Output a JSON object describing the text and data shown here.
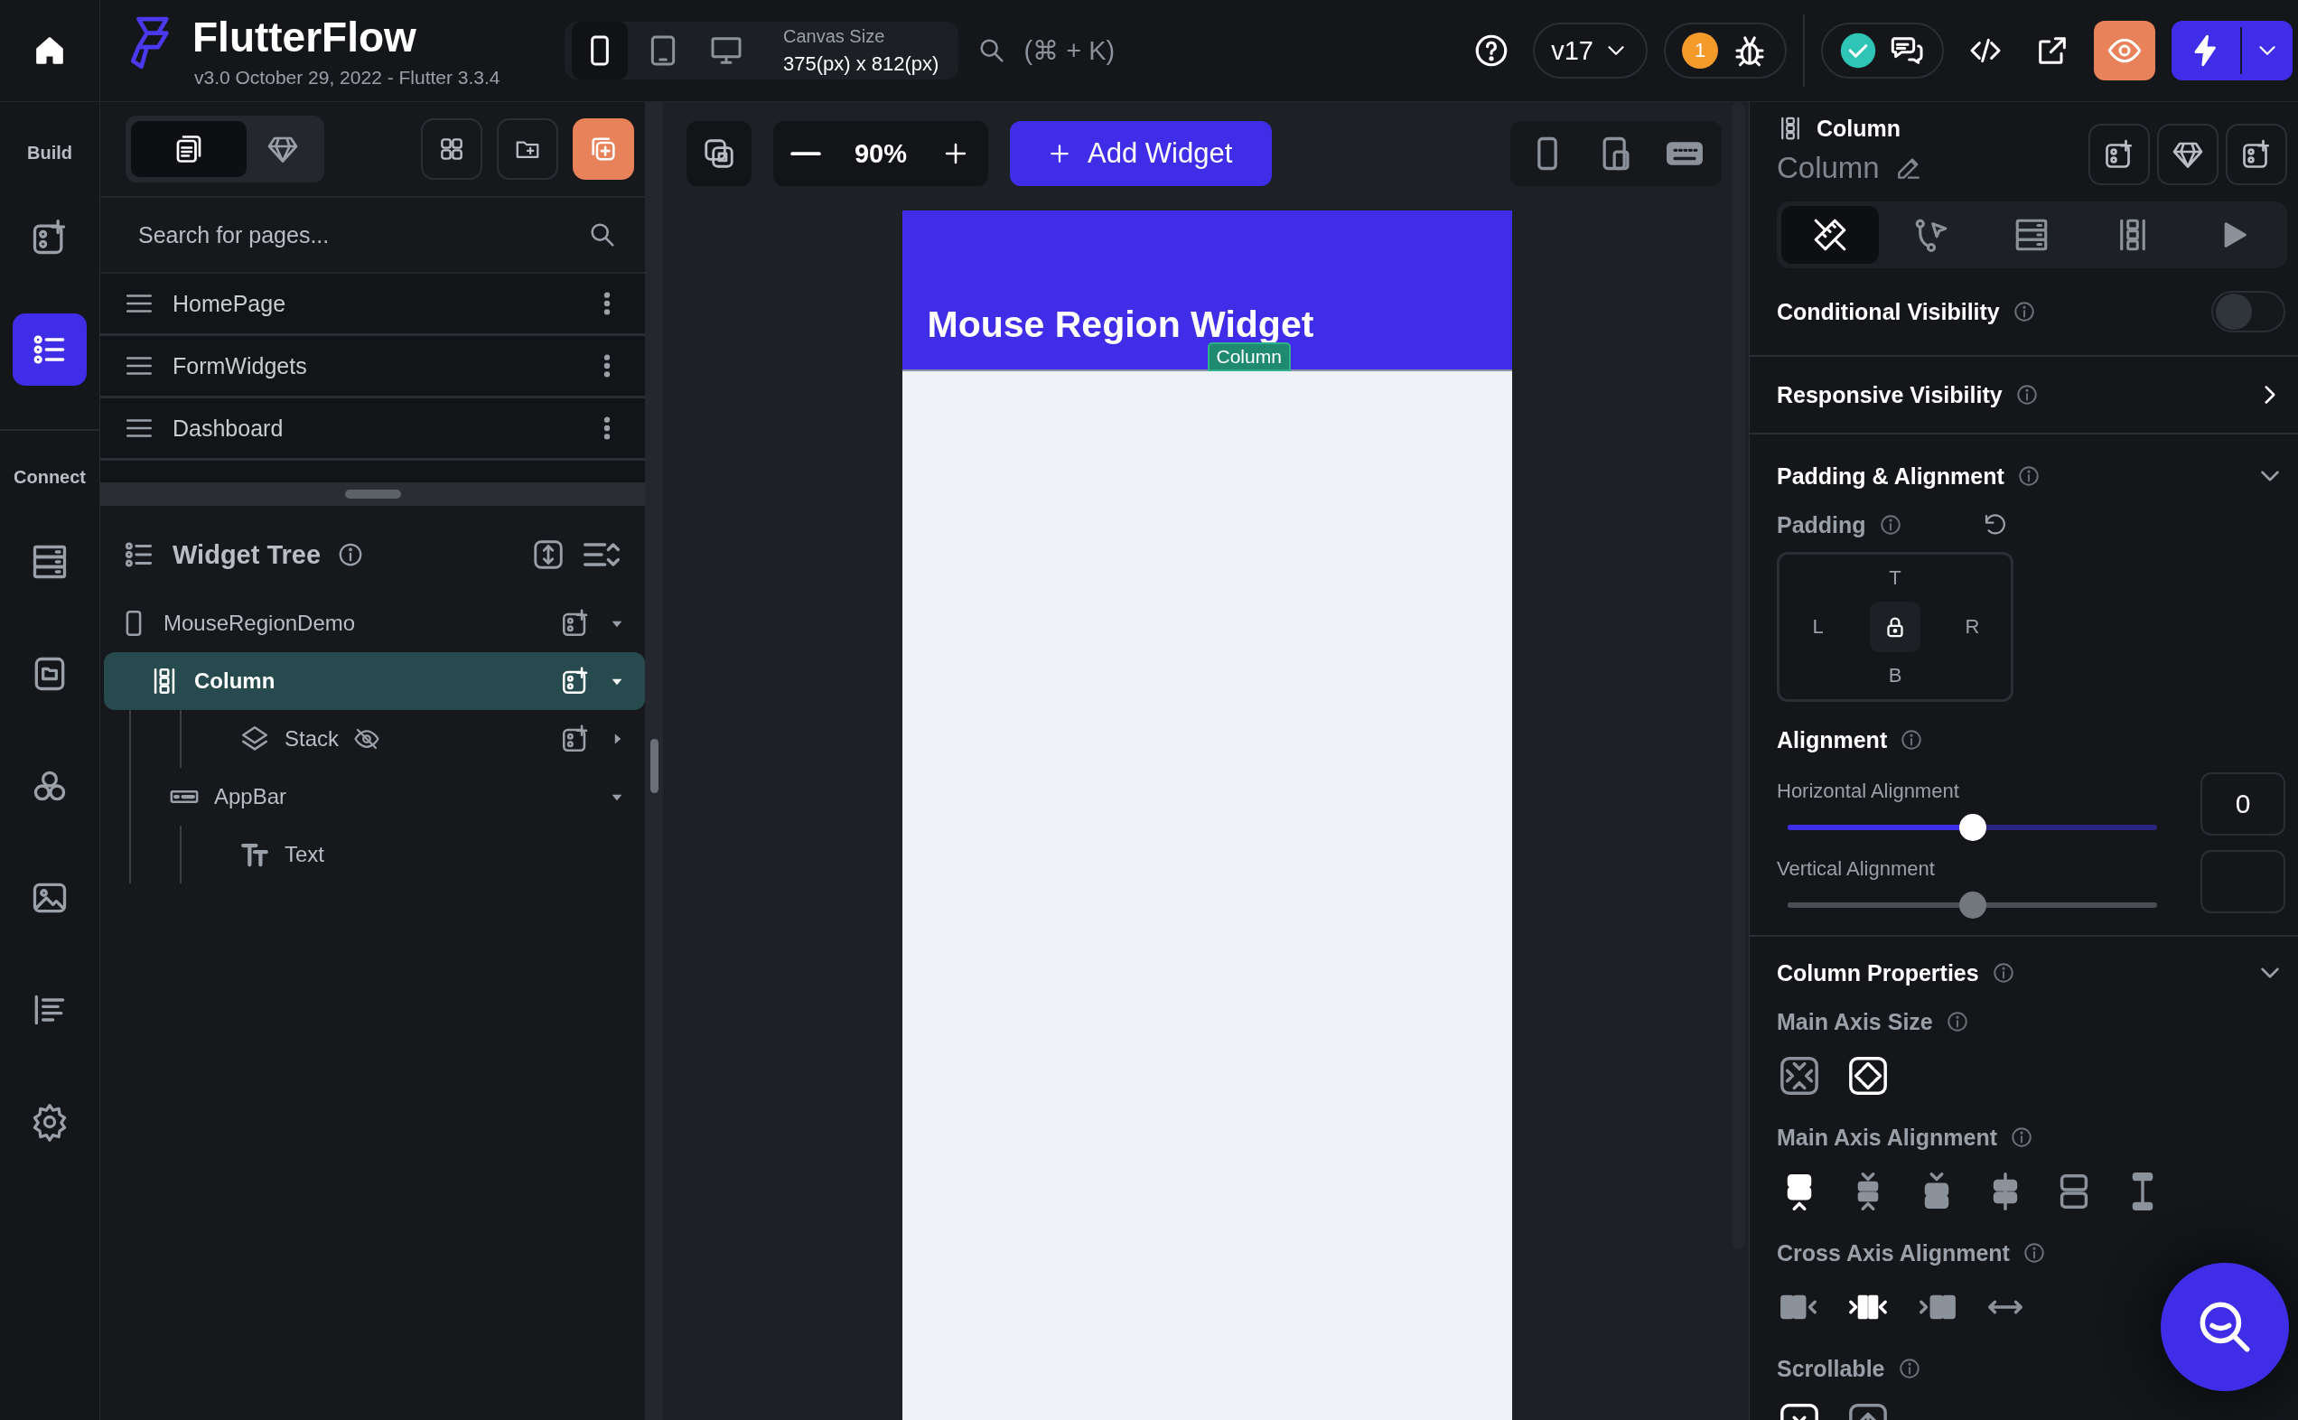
{
  "app": {
    "name": "FlutterFlow",
    "version": "v3.0 October 29, 2022 - Flutter 3.3.4"
  },
  "device_selector": {
    "devices": [
      {
        "selected": true
      },
      {
        "selected": false
      },
      {
        "selected": false
      }
    ],
    "canvas_size_label": "Canvas Size",
    "canvas_size": "375(px) x 812(px)"
  },
  "command_search": {
    "shortcut": "(⌘ + K)"
  },
  "version_dropdown": "v17",
  "issues_count": "1",
  "rail": {
    "sections": [
      {
        "label": "Build",
        "items": [
          {
            "selected": false
          },
          {
            "selected": true
          }
        ]
      },
      {
        "label": "Connect",
        "items": [
          {
            "selected": false
          },
          {
            "selected": false
          },
          {
            "selected": false
          },
          {
            "selected": false
          },
          {
            "selected": false
          },
          {
            "selected": false
          }
        ]
      }
    ]
  },
  "left_panel": {
    "tabs": [
      {
        "selected": true
      },
      {
        "selected": false
      }
    ],
    "search": {
      "placeholder": "Search for pages..."
    },
    "pages": [
      "HomePage",
      "FormWidgets",
      "Dashboard"
    ],
    "widget_tree": {
      "title": "Widget Tree",
      "nodes": [
        {
          "label": "MouseRegionDemo",
          "kind": "page",
          "selected": false,
          "expanded": true,
          "children": [
            {
              "label": "Column",
              "kind": "column",
              "selected": true,
              "expanded": true,
              "children": [
                {
                  "label": "Stack",
                  "kind": "stack",
                  "selected": false,
                  "expanded": false,
                  "hidden": true
                }
              ]
            },
            {
              "label": "AppBar",
              "kind": "appbar",
              "selected": false,
              "expanded": true,
              "children": [
                {
                  "label": "Text",
                  "kind": "text",
                  "selected": false
                }
              ]
            }
          ]
        }
      ]
    }
  },
  "canvas": {
    "zoom": "90%",
    "add_widget": "Add Widget",
    "appbar_title": "Mouse Region Widget",
    "selection_label": "Column"
  },
  "properties": {
    "type_label": "Column",
    "name": "Column",
    "tabs": [
      {
        "selected": true
      },
      {
        "selected": false
      },
      {
        "selected": false
      },
      {
        "selected": false
      },
      {
        "selected": false
      }
    ],
    "conditional_visibility": {
      "label": "Conditional Visibility",
      "on": false
    },
    "responsive_visibility": {
      "label": "Responsive Visibility"
    },
    "padding_alignment": {
      "title": "Padding & Alignment",
      "padding_label": "Padding",
      "top": "T",
      "left": "L",
      "right": "R",
      "bottom": "B"
    },
    "alignment": {
      "label": "Alignment",
      "horizontal": {
        "label": "Horizontal Alignment",
        "level": 0.5,
        "value": "0",
        "enabled": true
      },
      "vertical": {
        "label": "Vertical Alignment",
        "level": 0.5,
        "enabled": false
      }
    },
    "column_properties": {
      "title": "Column Properties",
      "main_axis_size": {
        "label": "Main Axis Size",
        "options": [
          {
            "selected": false
          },
          {
            "selected": true
          }
        ]
      },
      "main_axis_alignment": {
        "label": "Main Axis Alignment",
        "options": [
          {
            "selected": true
          },
          {
            "selected": false
          },
          {
            "selected": false
          },
          {
            "selected": false
          },
          {
            "selected": false
          },
          {
            "selected": false
          }
        ]
      },
      "cross_axis_alignment": {
        "label": "Cross Axis Alignment",
        "options": [
          {
            "selected": false
          },
          {
            "selected": true
          },
          {
            "selected": false
          },
          {
            "selected": false
          }
        ]
      },
      "scrollable": {
        "label": "Scrollable",
        "options": [
          {
            "selected": true
          },
          {
            "selected": false
          }
        ]
      }
    }
  }
}
